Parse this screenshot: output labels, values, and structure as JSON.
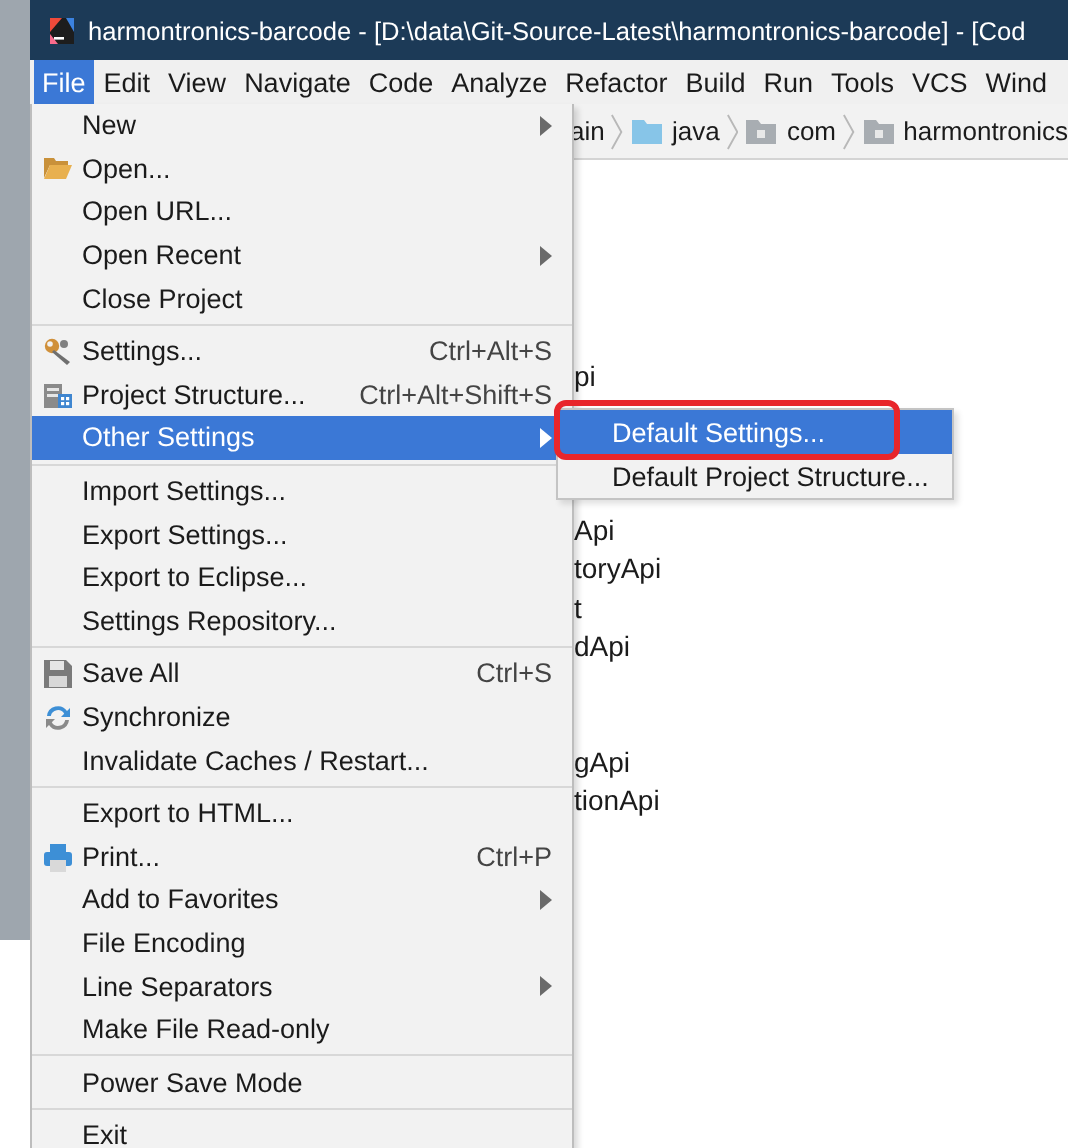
{
  "title_bar": {
    "title": "harmontronics-barcode - [D:\\data\\Git-Source-Latest\\harmontronics-barcode] - [Cod"
  },
  "menu_bar": [
    {
      "label": "File",
      "selected": true
    },
    {
      "label": "Edit",
      "selected": false
    },
    {
      "label": "View",
      "selected": false
    },
    {
      "label": "Navigate",
      "selected": false
    },
    {
      "label": "Code",
      "selected": false
    },
    {
      "label": "Analyze",
      "selected": false
    },
    {
      "label": "Refactor",
      "selected": false
    },
    {
      "label": "Build",
      "selected": false
    },
    {
      "label": "Run",
      "selected": false
    },
    {
      "label": "Tools",
      "selected": false
    },
    {
      "label": "VCS",
      "selected": false
    },
    {
      "label": "Wind",
      "selected": false
    }
  ],
  "breadcrumbs": [
    {
      "label": "ain"
    },
    {
      "label": "java"
    },
    {
      "label": "com"
    },
    {
      "label": "harmontronics"
    }
  ],
  "project_tree": [
    {
      "label": "pi"
    },
    {
      "label": "Api"
    },
    {
      "label": "toryApi"
    },
    {
      "label": "t"
    },
    {
      "label": "dApi"
    },
    {
      "label": "gApi"
    },
    {
      "label": "tionApi"
    }
  ],
  "file_menu": {
    "items": [
      {
        "kind": "item",
        "label": "New",
        "submenu": true,
        "selected": false
      },
      {
        "kind": "item",
        "label": "Open...",
        "selected": false
      },
      {
        "kind": "item",
        "label": "Open URL...",
        "selected": false
      },
      {
        "kind": "item",
        "label": "Open Recent",
        "submenu": true,
        "selected": false
      },
      {
        "kind": "item",
        "label": "Close Project",
        "selected": false
      },
      {
        "kind": "separator"
      },
      {
        "kind": "item",
        "label": "Settings...",
        "shortcut": "Ctrl+Alt+S",
        "selected": false
      },
      {
        "kind": "item",
        "label": "Project Structure...",
        "shortcut": "Ctrl+Alt+Shift+S",
        "selected": false
      },
      {
        "kind": "item",
        "label": "Other Settings",
        "submenu": true,
        "selected": true
      },
      {
        "kind": "separator"
      },
      {
        "kind": "item",
        "label": "Import Settings...",
        "selected": false
      },
      {
        "kind": "item",
        "label": "Export Settings...",
        "selected": false
      },
      {
        "kind": "item",
        "label": "Export to Eclipse...",
        "selected": false
      },
      {
        "kind": "item",
        "label": "Settings Repository...",
        "selected": false
      },
      {
        "kind": "separator"
      },
      {
        "kind": "item",
        "label": "Save All",
        "shortcut": "Ctrl+S",
        "selected": false
      },
      {
        "kind": "item",
        "label": "Synchronize",
        "selected": false
      },
      {
        "kind": "item",
        "label": "Invalidate Caches / Restart...",
        "selected": false
      },
      {
        "kind": "separator"
      },
      {
        "kind": "item",
        "label": "Export to HTML...",
        "selected": false
      },
      {
        "kind": "item",
        "label": "Print...",
        "shortcut": "Ctrl+P",
        "selected": false
      },
      {
        "kind": "item",
        "label": "Add to Favorites",
        "submenu": true,
        "selected": false
      },
      {
        "kind": "item",
        "label": "File Encoding",
        "selected": false
      },
      {
        "kind": "item",
        "label": "Line Separators",
        "submenu": true,
        "selected": false
      },
      {
        "kind": "item",
        "label": "Make File Read-only",
        "selected": false
      },
      {
        "kind": "separator"
      },
      {
        "kind": "item",
        "label": "Power Save Mode",
        "selected": false
      },
      {
        "kind": "separator"
      },
      {
        "kind": "item",
        "label": "Exit",
        "selected": false
      }
    ]
  },
  "other_settings_menu": {
    "items": [
      {
        "label": "Default Settings...",
        "selected": true,
        "annotated": true
      },
      {
        "label": "Default Project Structure...",
        "selected": false,
        "annotated": false
      }
    ]
  }
}
